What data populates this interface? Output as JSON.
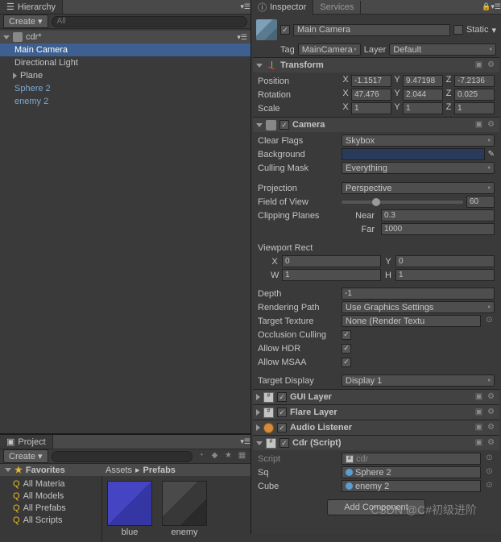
{
  "hierarchy": {
    "tab": "Hierarchy",
    "create": "Create",
    "search_placeholder": "All",
    "scene": "cdr*",
    "items": [
      {
        "name": "Main Camera",
        "selected": true
      },
      {
        "name": "Directional Light"
      },
      {
        "name": "Plane",
        "expandable": true
      },
      {
        "name": "Sphere 2",
        "prefab": true,
        "indent": true
      },
      {
        "name": "enemy 2",
        "prefab": true,
        "indent": true
      }
    ]
  },
  "project": {
    "tab": "Project",
    "create": "Create",
    "favorites": "Favorites",
    "fav_items": [
      "All Materia",
      "All Models",
      "All Prefabs",
      "All Scripts"
    ],
    "breadcrumb": [
      "Assets",
      "Prefabs"
    ],
    "assets": [
      {
        "name": "blue",
        "type": "blue"
      },
      {
        "name": "enemy",
        "type": "dark"
      }
    ]
  },
  "inspector": {
    "tab": "Inspector",
    "services_tab": "Services",
    "name": "Main Camera",
    "static": "Static",
    "tag_label": "Tag",
    "tag_value": "MainCamera",
    "layer_label": "Layer",
    "layer_value": "Default"
  },
  "transform": {
    "title": "Transform",
    "position": "Position",
    "rotation": "Rotation",
    "scale": "Scale",
    "pos": {
      "x": "-1.1517",
      "y": "9.47198",
      "z": "-7.2136"
    },
    "rot": {
      "x": "47.476",
      "y": "2.044",
      "z": "0.025"
    },
    "scl": {
      "x": "1",
      "y": "1",
      "z": "1"
    }
  },
  "camera": {
    "title": "Camera",
    "clear_flags": "Clear Flags",
    "clear_flags_v": "Skybox",
    "background": "Background",
    "culling_mask": "Culling Mask",
    "culling_mask_v": "Everything",
    "projection": "Projection",
    "projection_v": "Perspective",
    "fov": "Field of View",
    "fov_v": "60",
    "clipping": "Clipping Planes",
    "near": "Near",
    "near_v": "0.3",
    "far": "Far",
    "far_v": "1000",
    "viewport": "Viewport Rect",
    "vx": "0",
    "vy": "0",
    "vw": "1",
    "vh": "1",
    "depth": "Depth",
    "depth_v": "-1",
    "render_path": "Rendering Path",
    "render_path_v": "Use Graphics Settings",
    "target_tex": "Target Texture",
    "target_tex_v": "None (Render Textu",
    "occlusion": "Occlusion Culling",
    "hdr": "Allow HDR",
    "msaa": "Allow MSAA",
    "target_display": "Target Display",
    "target_display_v": "Display 1"
  },
  "components": {
    "gui_layer": "GUI Layer",
    "flare_layer": "Flare Layer",
    "audio_listener": "Audio Listener"
  },
  "cdr_script": {
    "title": "Cdr (Script)",
    "script": "Script",
    "script_v": "cdr",
    "sq": "Sq",
    "sq_v": "Sphere 2",
    "cube": "Cube",
    "cube_v": "enemy 2"
  },
  "add_component": "Add Component",
  "watermark": "CSDN @C#初级进阶"
}
